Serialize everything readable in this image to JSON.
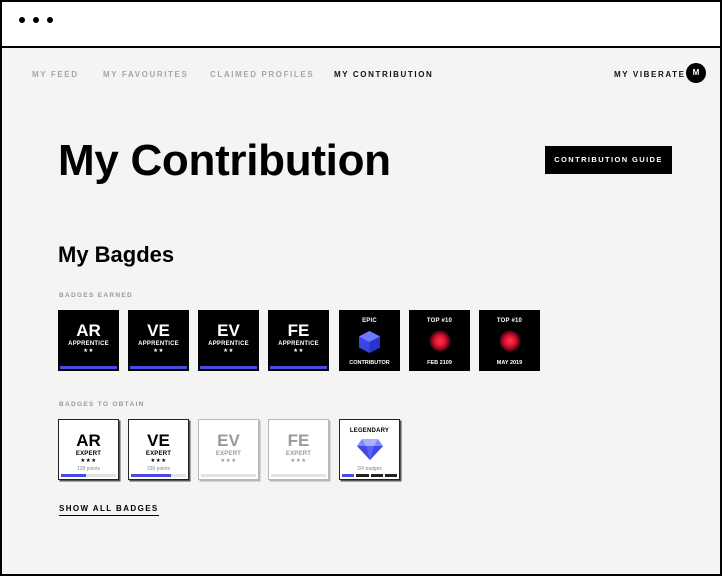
{
  "window": {
    "title_dots": [
      "dot",
      "dot",
      "dot"
    ]
  },
  "nav": {
    "items": [
      {
        "label": "MY FEED",
        "active": false
      },
      {
        "label": "MY FAVOURITES",
        "active": false
      },
      {
        "label": "CLAIMED PROFILES",
        "active": false
      },
      {
        "label": "MY CONTRIBUTION",
        "active": true
      }
    ],
    "account_label": "MY VIBERATE",
    "avatar_initial": "M"
  },
  "page": {
    "title": "My Contribution",
    "guide_button": "CONTRIBUTION GUIDE"
  },
  "badges_section": {
    "title": "My Bagdes",
    "earned_label": "BADGES EARNED",
    "earned": [
      {
        "code": "AR",
        "level": "APPRENTICE",
        "stars": "★★"
      },
      {
        "code": "VE",
        "level": "APPRENTICE",
        "stars": "★★"
      },
      {
        "code": "EV",
        "level": "APPRENTICE",
        "stars": "★★"
      },
      {
        "code": "FE",
        "level": "APPRENTICE",
        "stars": "★★"
      },
      {
        "top": "EPIC",
        "bottom": "CONTRIBUTOR",
        "icon": "hexagon-gem-icon"
      },
      {
        "top": "TOP #10",
        "bottom": "FEB 2109",
        "icon": "red-glow-icon"
      },
      {
        "top": "TOP #10",
        "bottom": "MAY 2019",
        "icon": "red-glow-icon"
      }
    ],
    "obtain_label": "BADGES TO OBTAIN",
    "to_obtain": [
      {
        "code": "AR",
        "level": "EXPERT",
        "stars": "★★★",
        "points": "128 points",
        "progress": 0.45
      },
      {
        "code": "VE",
        "level": "EXPERT",
        "stars": "★★★",
        "points": "330 points",
        "progress": 0.72
      },
      {
        "code": "EV",
        "level": "EXPERT",
        "stars": "★★★",
        "points": "",
        "progress": 0
      },
      {
        "code": "FE",
        "level": "EXPERT",
        "stars": "★★★",
        "points": "",
        "progress": 0
      },
      {
        "top": "LEGENDARY",
        "bottom": "2/4 badges",
        "icon": "diamond-icon",
        "segments_total": 4,
        "segments_done": 1
      }
    ],
    "show_all": "SHOW ALL BADGES"
  },
  "colors": {
    "accent": "#4a4be0",
    "background": "#f4f4f2",
    "dark": "#000000",
    "glow": "#e0102f"
  }
}
